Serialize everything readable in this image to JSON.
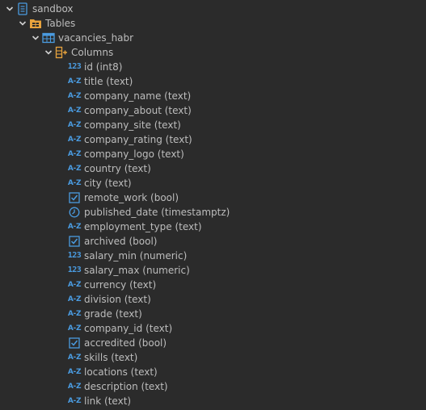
{
  "tree": {
    "database": {
      "label": "sandbox",
      "icon": "database-icon"
    },
    "tables": {
      "label": "Tables",
      "icon": "tables-folder-icon"
    },
    "table": {
      "label": "vacancies_habr",
      "icon": "table-icon"
    },
    "columns_folder": {
      "label": "Columns",
      "icon": "columns-folder-icon"
    },
    "columns": [
      {
        "label": "id (int8)",
        "type": "int"
      },
      {
        "label": "title (text)",
        "type": "text"
      },
      {
        "label": "company_name (text)",
        "type": "text"
      },
      {
        "label": "company_about (text)",
        "type": "text"
      },
      {
        "label": "company_site (text)",
        "type": "text"
      },
      {
        "label": "company_rating (text)",
        "type": "text"
      },
      {
        "label": "company_logo (text)",
        "type": "text"
      },
      {
        "label": "country (text)",
        "type": "text"
      },
      {
        "label": "city (text)",
        "type": "text"
      },
      {
        "label": "remote_work (bool)",
        "type": "bool"
      },
      {
        "label": "published_date (timestamptz)",
        "type": "time"
      },
      {
        "label": "employment_type (text)",
        "type": "text"
      },
      {
        "label": "archived (bool)",
        "type": "bool"
      },
      {
        "label": "salary_min (numeric)",
        "type": "int"
      },
      {
        "label": "salary_max (numeric)",
        "type": "int"
      },
      {
        "label": "currency (text)",
        "type": "text"
      },
      {
        "label": "division (text)",
        "type": "text"
      },
      {
        "label": "grade (text)",
        "type": "text"
      },
      {
        "label": "company_id (text)",
        "type": "text"
      },
      {
        "label": "accredited (bool)",
        "type": "bool"
      },
      {
        "label": "skills (text)",
        "type": "text"
      },
      {
        "label": "locations (text)",
        "type": "text"
      },
      {
        "label": "description (text)",
        "type": "text"
      },
      {
        "label": "link (text)",
        "type": "text"
      }
    ]
  },
  "type_glyphs": {
    "int": "123",
    "text": "A-Z"
  },
  "colors": {
    "background": "#2b2b2b",
    "type_icon": "#4a9be0",
    "folder": "#e8a33d"
  }
}
